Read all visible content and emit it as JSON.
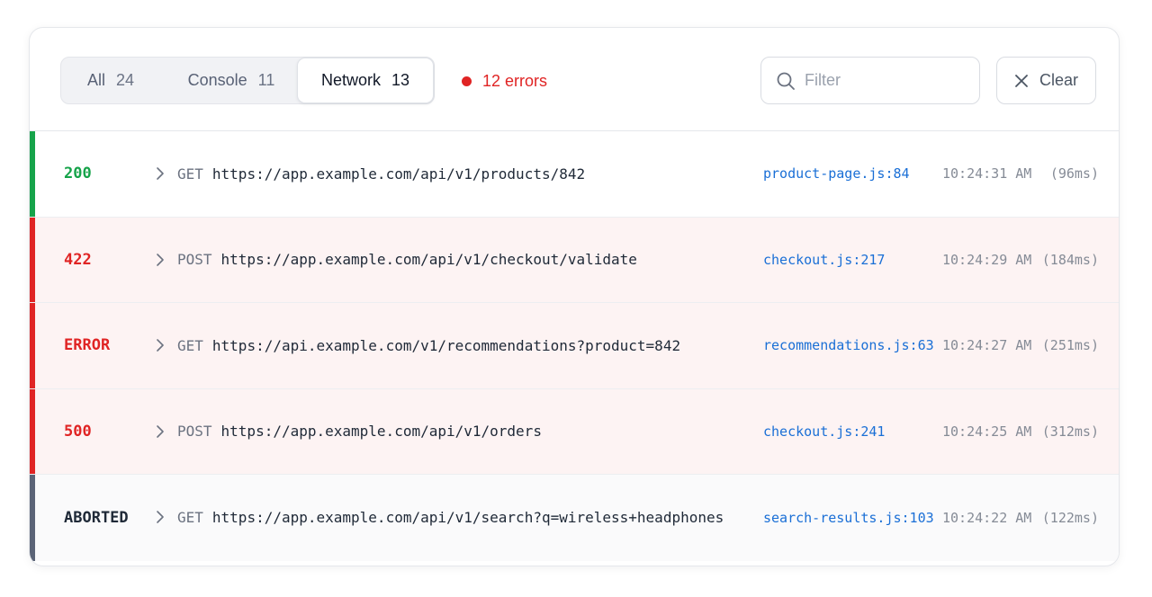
{
  "tabs": [
    {
      "label": "All",
      "count": "24"
    },
    {
      "label": "Console",
      "count": "11"
    },
    {
      "label": "Network",
      "count": "13"
    }
  ],
  "errors_label": "12 errors",
  "filter": {
    "placeholder": "Filter",
    "value": ""
  },
  "clear_label": "Clear",
  "colors": {
    "success": "#16a34a",
    "error": "#e02424",
    "aborted": "#1f2937",
    "aborted_bar": "#5b6477",
    "error_row_bg": "#fdf3f3",
    "aborted_row_bg": "#fafafb",
    "link": "#1a6fd6"
  },
  "rows": [
    {
      "status": "200",
      "state": "success",
      "method": "GET",
      "url": "https://app.example.com/api/v1/products/842",
      "source": "product-page.js:84",
      "time": "10:24:31 AM",
      "duration": "(96ms)"
    },
    {
      "status": "422",
      "state": "error",
      "method": "POST",
      "url": "https://app.example.com/api/v1/checkout/validate",
      "source": "checkout.js:217",
      "time": "10:24:29 AM",
      "duration": "(184ms)"
    },
    {
      "status": "ERROR",
      "state": "error",
      "method": "GET",
      "url": "https://api.example.com/v1/recommendations?product=842",
      "source": "recommendations.js:63",
      "time": "10:24:27 AM",
      "duration": "(251ms)"
    },
    {
      "status": "500",
      "state": "error",
      "method": "POST",
      "url": "https://app.example.com/api/v1/orders",
      "source": "checkout.js:241",
      "time": "10:24:25 AM",
      "duration": "(312ms)"
    },
    {
      "status": "ABORTED",
      "state": "aborted",
      "method": "GET",
      "url": "https://app.example.com/api/v1/search?q=wireless+headphones",
      "source": "search-results.js:103",
      "time": "10:24:22 AM",
      "duration": "(122ms)"
    }
  ]
}
